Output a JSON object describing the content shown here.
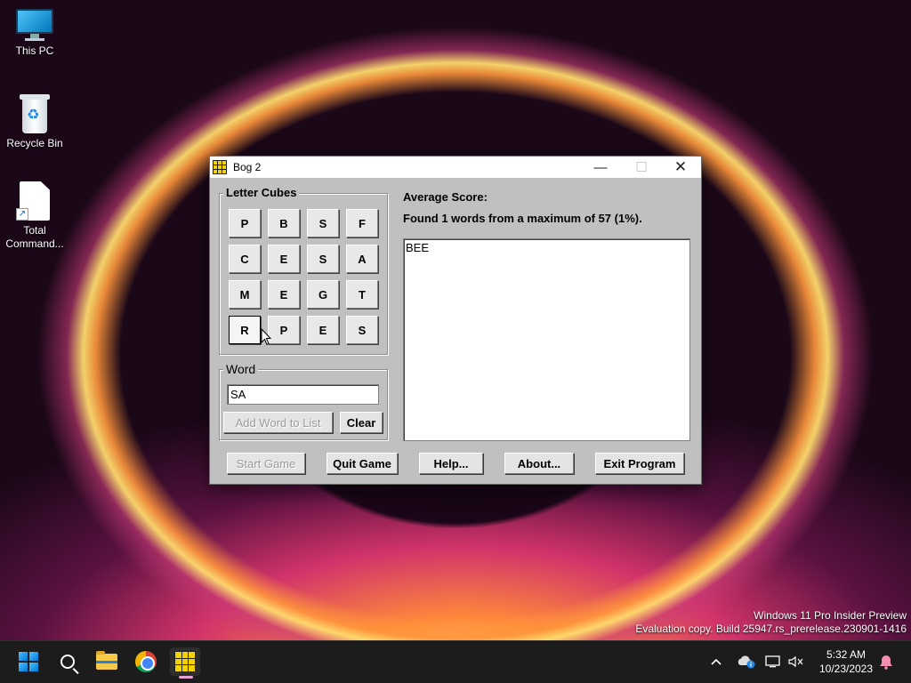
{
  "desktop": {
    "icons": [
      {
        "label": "This PC"
      },
      {
        "label": "Recycle Bin"
      },
      {
        "label": "Total Command..."
      }
    ],
    "watermark": {
      "line1": "Windows 11 Pro Insider Preview",
      "line2": "Evaluation copy. Build 25947.rs_prerelease.230901-1416"
    }
  },
  "window": {
    "title": "Bog 2",
    "controls": {
      "minimize": "—",
      "maximize": "☐",
      "close": "✕"
    },
    "letter_cubes": {
      "label": "Letter Cubes",
      "rows": [
        [
          "P",
          "B",
          "S",
          "F"
        ],
        [
          "C",
          "E",
          "S",
          "A"
        ],
        [
          "M",
          "E",
          "G",
          "T"
        ],
        [
          "R",
          "P",
          "E",
          "S"
        ]
      ]
    },
    "word": {
      "label": "Word",
      "value": "SA",
      "add_button": "Add Word to List",
      "clear_button": "Clear"
    },
    "score": {
      "average_label": "Average Score:",
      "found_text": "Found 1 words from a maximum of 57 (1%)."
    },
    "found_words": [
      "BEE"
    ],
    "buttons": {
      "start": "Start Game",
      "quit": "Quit Game",
      "help": "Help...",
      "about": "About...",
      "exit": "Exit Program"
    }
  },
  "taskbar": {
    "icons": [
      "windows-start-icon",
      "search-icon",
      "file-explorer-icon",
      "chrome-icon",
      "bog-app-icon"
    ],
    "tray": {
      "chevron": "^",
      "time": "5:32 AM",
      "date": "10/23/2023"
    }
  }
}
